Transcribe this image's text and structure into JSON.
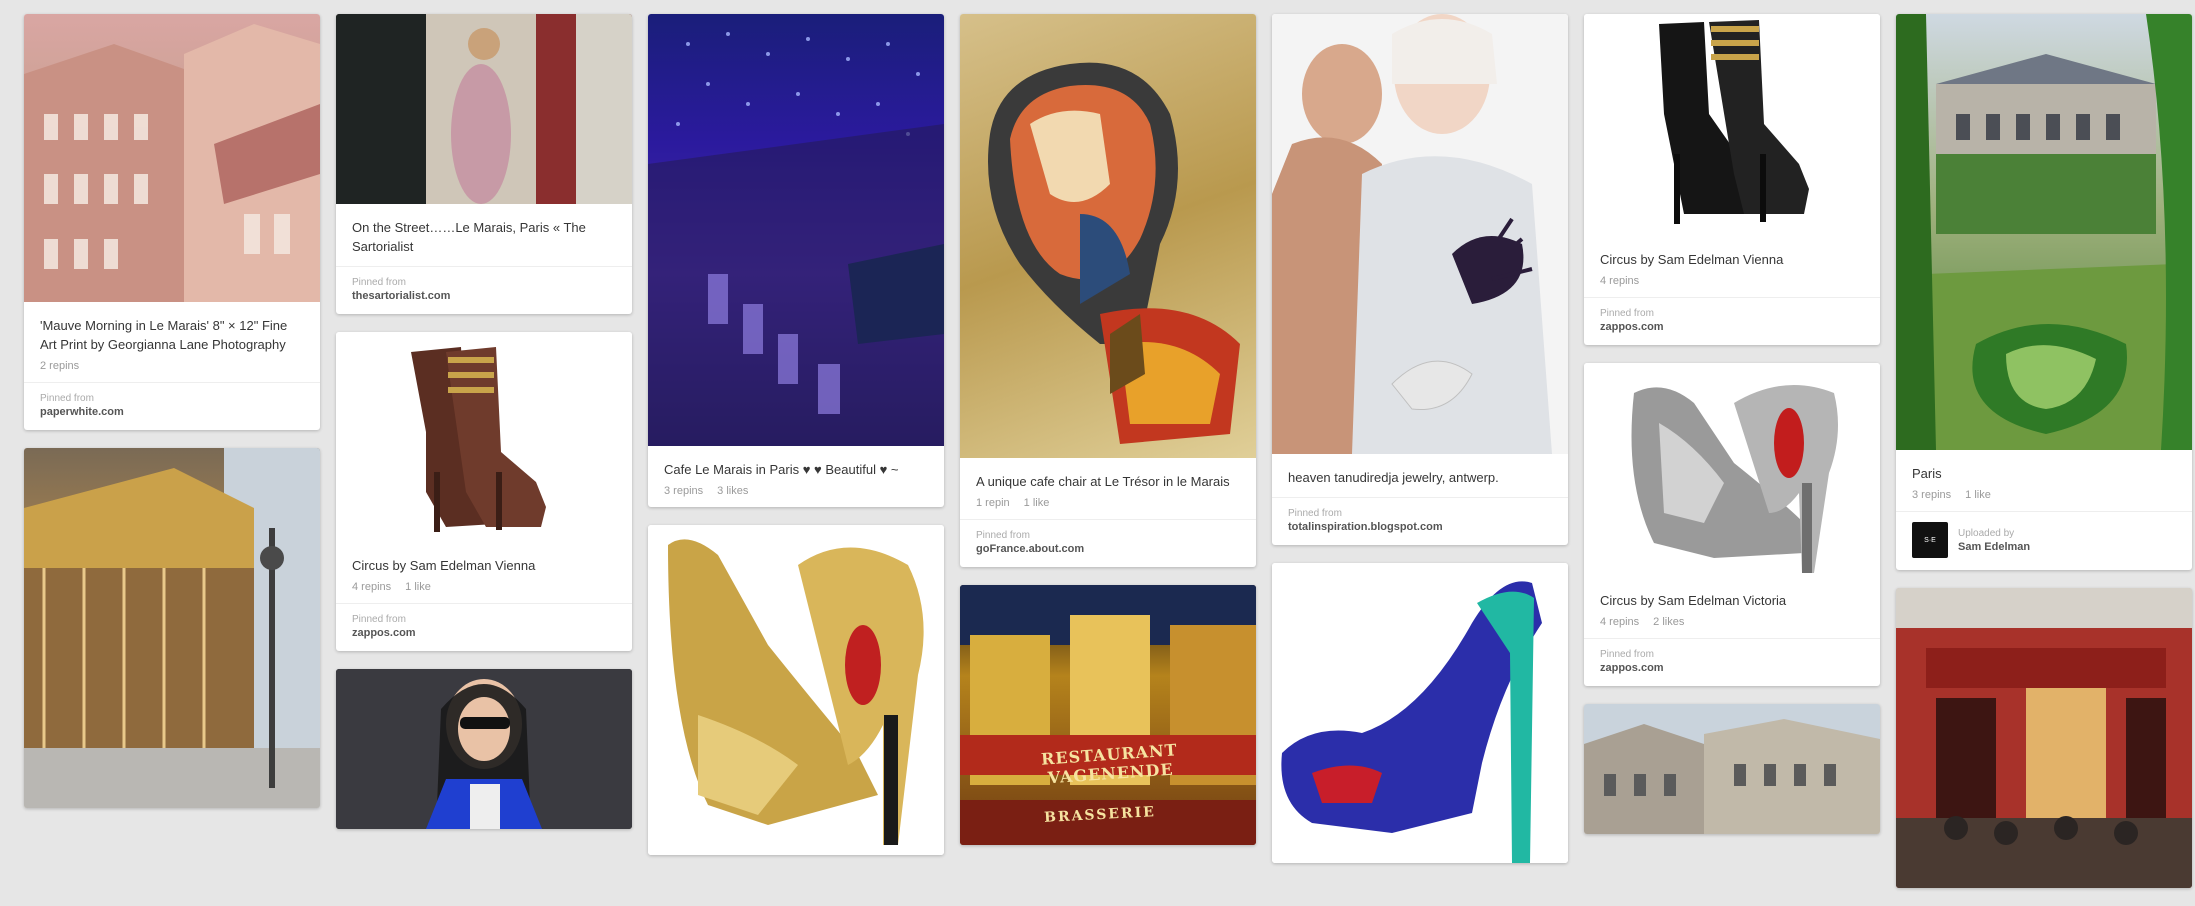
{
  "source_label": "Pinned from",
  "uploaded_label": "Uploaded by",
  "pins": {
    "p1": {
      "title": "'Mauve Morning in Le Marais' 8\" × 12\" Fine Art Print by Georgianna Lane Photography",
      "stats": [
        "2 repins"
      ],
      "host": "paperwhite.com",
      "image": "pink parisian rooftops"
    },
    "p2": {
      "image": "carousel in paris park"
    },
    "p3": {
      "title": "On the Street……Le Marais, Paris « The Sartorialist",
      "host": "thesartorialist.com",
      "image": "woman in floral outfit on street"
    },
    "p4": {
      "title": "Circus by Sam Edelman Vienna",
      "stats": [
        "4 repins",
        "1 like"
      ],
      "host": "zappos.com",
      "image": "brown studded ankle boot"
    },
    "p5": {
      "image": "woman in blue coat and sunglasses"
    },
    "p6": {
      "title": "Cafe Le Marais in Paris ♥ ♥ Beautiful ♥ ~",
      "stats": [
        "3 repins",
        "3 likes"
      ],
      "image": "cafe terrace with blue lights at night"
    },
    "p7": {
      "image": "gold peep toe platform pump"
    },
    "p8": {
      "title": "A unique cafe chair at Le Trésor in le Marais",
      "stats": [
        "1 repin",
        "1 like"
      ],
      "host": "goFrance.about.com",
      "image": "painted cafe chair back"
    },
    "p9": {
      "image": "restaurant vagenende facade",
      "sign": "RESTAURANT VAGENENDE",
      "sign2": "BRASSERIE"
    },
    "p10": {
      "title": "heaven tanudiredja jewelry, antwerp.",
      "host": "totalinspiration.blogspot.com",
      "image": "fashion models with jewelry"
    },
    "p11": {
      "image": "blue suede pump with teal heel"
    },
    "p12": {
      "title": "Circus by Sam Edelman Vienna",
      "stats": [
        "4 repins"
      ],
      "host": "zappos.com",
      "image": "black studded ankle boot"
    },
    "p13": {
      "title": "Circus by Sam Edelman Victoria",
      "stats": [
        "4 repins",
        "2 likes"
      ],
      "host": "zappos.com",
      "image": "silver metallic pump"
    },
    "p14": {
      "image": "parisian courtyard building"
    },
    "p15": {
      "title": "Paris",
      "stats": [
        "3 repins",
        "1 like"
      ],
      "uploader": "Sam Edelman",
      "image": "garden courtyard in le marais"
    },
    "p16": {
      "image": "red cafe storefront"
    }
  },
  "colors": {
    "page_bg": "#e6e6e6",
    "card_bg": "#ffffff"
  }
}
